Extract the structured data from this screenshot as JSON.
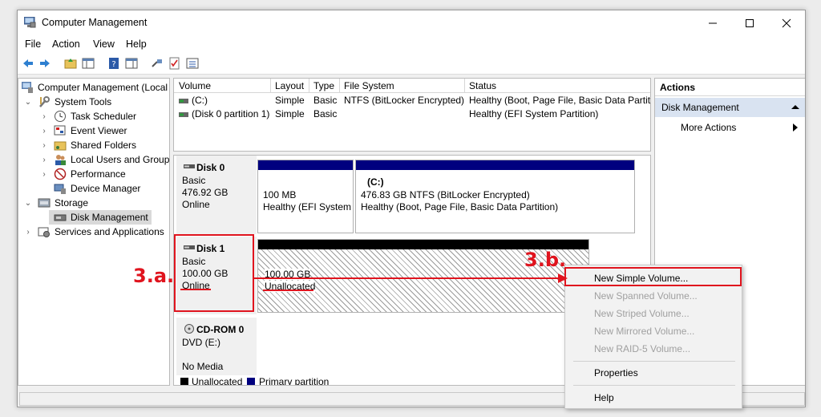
{
  "window": {
    "title": "Computer Management"
  },
  "menu": [
    "File",
    "Action",
    "View",
    "Help"
  ],
  "tree": {
    "root": "Computer Management (Local",
    "system_tools": "System Tools",
    "items": [
      "Task Scheduler",
      "Event Viewer",
      "Shared Folders",
      "Local Users and Groups",
      "Performance",
      "Device Manager"
    ],
    "storage": "Storage",
    "disk_management": "Disk Management",
    "services": "Services and Applications"
  },
  "volume_list": {
    "headers": [
      "Volume",
      "Layout",
      "Type",
      "File System",
      "Status"
    ],
    "rows": [
      [
        "(C:)",
        "Simple",
        "Basic",
        "NTFS (BitLocker Encrypted)",
        "Healthy (Boot, Page File, Basic Data Partitio"
      ],
      [
        "(Disk 0 partition 1)",
        "Simple",
        "Basic",
        "",
        "Healthy (EFI System Partition)"
      ]
    ]
  },
  "disks": {
    "disk0": {
      "name": "Disk 0",
      "type": "Basic",
      "size": "476.92 GB",
      "status": "Online",
      "p1_size": "100 MB",
      "p1_status": "Healthy (EFI System",
      "p2_name": "(C:)",
      "p2_size": "476.83 GB NTFS (BitLocker Encrypted)",
      "p2_status": "Healthy (Boot, Page File, Basic Data Partition)"
    },
    "disk1": {
      "name": "Disk 1",
      "type": "Basic",
      "size": "100.00 GB",
      "status": "Online",
      "p1_size": "100.00 GB",
      "p1_status": "Unallocated"
    },
    "cdrom": {
      "name": "CD-ROM 0",
      "type": "DVD (E:)",
      "status": "No Media"
    }
  },
  "legend": {
    "unallocated": "Unallocated",
    "primary": "Primary partition"
  },
  "actions": {
    "header": "Actions",
    "section": "Disk Management",
    "more": "More Actions"
  },
  "context_menu": {
    "items": [
      "New Simple Volume...",
      "New Spanned Volume...",
      "New Striped Volume...",
      "New Mirrored Volume...",
      "New RAID-5 Volume..."
    ],
    "properties": "Properties",
    "help": "Help"
  },
  "annotations": {
    "a": "3.a.",
    "b": "3.b."
  },
  "colors": {
    "primary_partition": "#00007f",
    "unallocated": "#000000",
    "annotation": "#e0141e",
    "selection": "#d9d9d9",
    "actions_section": "#d9e3f1"
  }
}
